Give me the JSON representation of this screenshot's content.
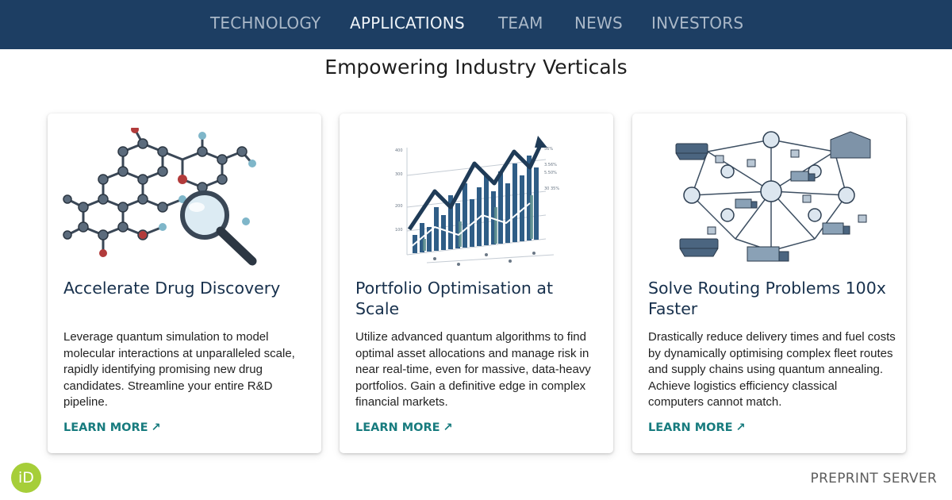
{
  "nav": {
    "items": [
      {
        "label": "TECHNOLOGY",
        "active": false
      },
      {
        "label": "APPLICATIONS",
        "active": true
      },
      {
        "label": "TEAM",
        "active": false
      },
      {
        "label": "NEWS",
        "active": false
      },
      {
        "label": "INVESTORS",
        "active": false
      }
    ]
  },
  "page": {
    "title": "Empowering Industry Verticals"
  },
  "cards": [
    {
      "illustration": "molecule-magnifier-icon",
      "title": "Accelerate Drug Discovery",
      "text": "Leverage quantum simulation to model molecular interactions at unparalleled scale, rapidly  identifying promising new drug candidates. Streamline your entire R&D pipeline.",
      "link": "LEARN MORE",
      "link_icon": "arrow-up-right-icon"
    },
    {
      "illustration": "financial-chart-icon",
      "title": "Portfolio Optimisation at Scale",
      "text": "Utilize advanced quantum algorithms to find optimal asset allocations and manage risk in near real-time, even for massive, data-heavy portfolios. Gain a definitive edge in complex financial markets.",
      "link": "LEARN MORE",
      "link_icon": "arrow-up-right-icon"
    },
    {
      "illustration": "logistics-network-icon",
      "title": "Solve Routing Problems 100x Faster",
      "text": "Drastically reduce delivery times and fuel costs by dynamically optimising complex fleet routes and supply chains using quantum annealing. Achieve logistics efficiency classical computers cannot match.",
      "link": "LEARN MORE",
      "link_icon": "arrow-up-right-icon"
    }
  ],
  "footer": {
    "badge": "iD",
    "label": "PREPRINT SERVER"
  },
  "colors": {
    "nav_bg": "#1d3e63",
    "nav_text": "#aab8c8",
    "nav_active": "#eef3f8",
    "link": "#177b7e",
    "badge": "#a6ce39"
  }
}
